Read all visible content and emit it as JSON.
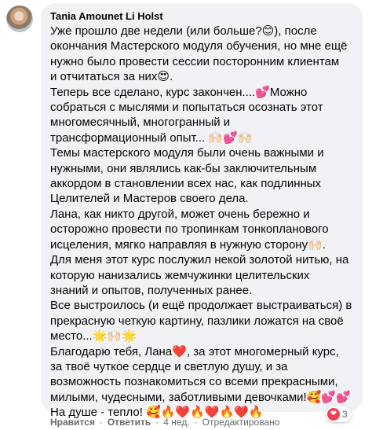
{
  "comment": {
    "author": "Tania Amounet Li Holst",
    "lines": [
      "Уже прошло две недели (или больше?😊), после",
      "окончания Мастерского модуля обучения, но мне ещё",
      "нужно было провести сессии посторонним клиентам",
      "и отчитаться за них😍.",
      "Теперь все сделано, курс закончен....💕Можно",
      "собраться с мыслями и попытаться осознать этот",
      "многомесячный, многогранный и",
      "трансформационный опыт... 🙌🏻💕🙌🏻",
      "Темы мастерского модуля были очень важными и",
      "нужными, они являлись как-бы заключительным",
      "аккордом в становлении всех нас, как подлинных",
      "Целителей и Мастеров своего дела.",
      "Лана, как никто другой, может очень бережно и",
      "осторожно провести по тропинкам тонкопланового",
      "исцеления, мягко направляя в нужную сторону🙌🏻.",
      "Для меня этот курс послужил некой золотой нитью, на",
      "которую нанизались жемчужинки целительских",
      "знаний и опытов, полученных ранее.",
      "Все выстроилось (и ещё продолжает выстраиваться) в",
      "прекрасную четкую картину, пазлики ложатся на своё",
      "место...🌟🙌🏻🌟",
      "Благодарю тебя, Лана❤️, за этот многомерный курс,",
      "за твоё чуткое сердце и светлую душу, и за",
      "возможность познакомиться со всеми прекрасными,",
      "милыми, чудесными, заботливыми девочками!🥰💕💕",
      "На душе - тепло! 🥰🔥❤️🔥❤️🔥❤️🔥"
    ]
  },
  "reactions": {
    "icon": "heart-reaction-icon",
    "count": "3",
    "color": "#f33e58"
  },
  "actions": {
    "like": "Нравится",
    "reply": "Ответить",
    "time": "4 нед.",
    "edited": "Отредактировано"
  },
  "colors": {
    "bubble": "#f0f2f5",
    "text": "#050505",
    "meta": "#65676b"
  }
}
